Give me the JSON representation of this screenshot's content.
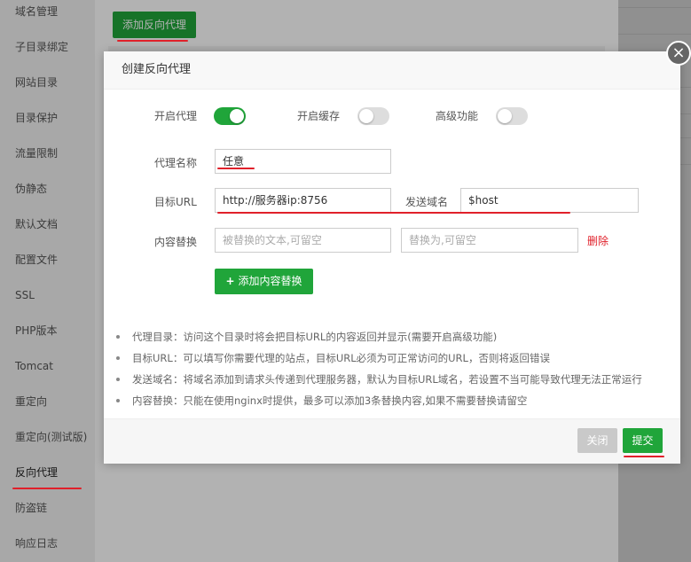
{
  "sidebar": {
    "items": [
      {
        "label": "域名管理"
      },
      {
        "label": "子目录绑定"
      },
      {
        "label": "网站目录"
      },
      {
        "label": "目录保护"
      },
      {
        "label": "流量限制"
      },
      {
        "label": "伪静态"
      },
      {
        "label": "默认文档"
      },
      {
        "label": "配置文件"
      },
      {
        "label": "SSL"
      },
      {
        "label": "PHP版本"
      },
      {
        "label": "Tomcat"
      },
      {
        "label": "重定向"
      },
      {
        "label": "重定向(测试版)"
      },
      {
        "label": "反向代理"
      },
      {
        "label": "防盗链"
      },
      {
        "label": "响应日志"
      }
    ],
    "active": "反向代理"
  },
  "toolbar": {
    "add_proxy_label": "添加反向代理"
  },
  "modal": {
    "title": "创建反向代理",
    "close_icon": "×",
    "toggles": {
      "enable_proxy": {
        "label": "开启代理",
        "on": true
      },
      "enable_cache": {
        "label": "开启缓存",
        "on": false
      },
      "advanced": {
        "label": "高级功能",
        "on": false
      }
    },
    "proxy_name": {
      "label": "代理名称",
      "value": "任意"
    },
    "target_url": {
      "label": "目标URL",
      "value": "http://服务器ip:8756"
    },
    "send_domain": {
      "label": "发送域名",
      "value": "$host"
    },
    "content_replace": {
      "label": "内容替换",
      "from_placeholder": "被替换的文本,可留空",
      "to_placeholder": "替换为,可留空",
      "delete_label": "删除"
    },
    "add_content_replace_label": "添加内容替换",
    "add_icon": "+",
    "tips": [
      "代理目录：访问这个目录时将会把目标URL的内容返回并显示(需要开启高级功能)",
      "目标URL：可以填写你需要代理的站点，目标URL必须为可正常访问的URL，否则将返回错误",
      "发送域名：将域名添加到请求头传递到代理服务器，默认为目标URL域名，若设置不当可能导致代理无法正常运行",
      "内容替换：只能在使用nginx时提供，最多可以添加3条替换内容,如果不需要替换请留空"
    ],
    "footer": {
      "close_label": "关闭",
      "submit_label": "提交"
    }
  },
  "colors": {
    "accent": "#20a53a",
    "danger": "#e0202a",
    "annotation_underline": "#e0202a"
  }
}
